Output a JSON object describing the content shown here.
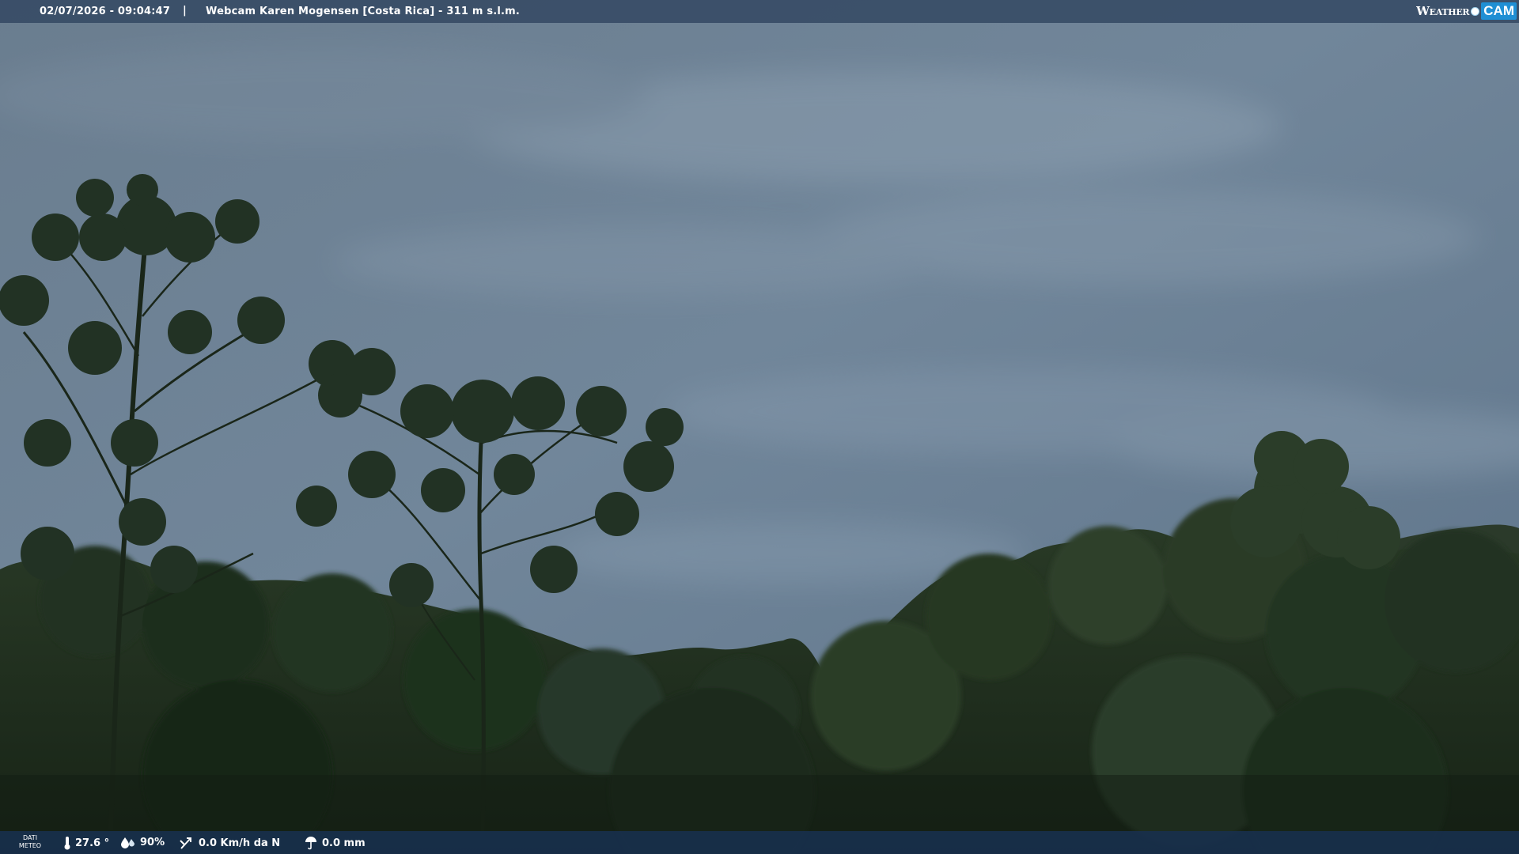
{
  "topbar": {
    "datetime": "02/07/2026 - 09:04:47",
    "separator": "|",
    "title": "Webcam Karen Mogensen [Costa Rica] - 311 m s.l.m."
  },
  "brand": {
    "weather": "Weather",
    "cam": "CAM",
    "accent_color": "#1f8fd4"
  },
  "bottombar": {
    "label_line1": "DATI",
    "label_line2": "METEO",
    "temperature": "27.6 °",
    "humidity": "90%",
    "wind": "0.0 Km/h da N",
    "rain": "0.0 mm",
    "icons": [
      "thermometer-icon",
      "humidity-icon",
      "wind-icon",
      "rain-icon"
    ]
  },
  "colors": {
    "sky": "#6e8295",
    "foliage": "#1e2e1d",
    "bar_top": "#314560",
    "bar_bottom": "#18304e"
  }
}
